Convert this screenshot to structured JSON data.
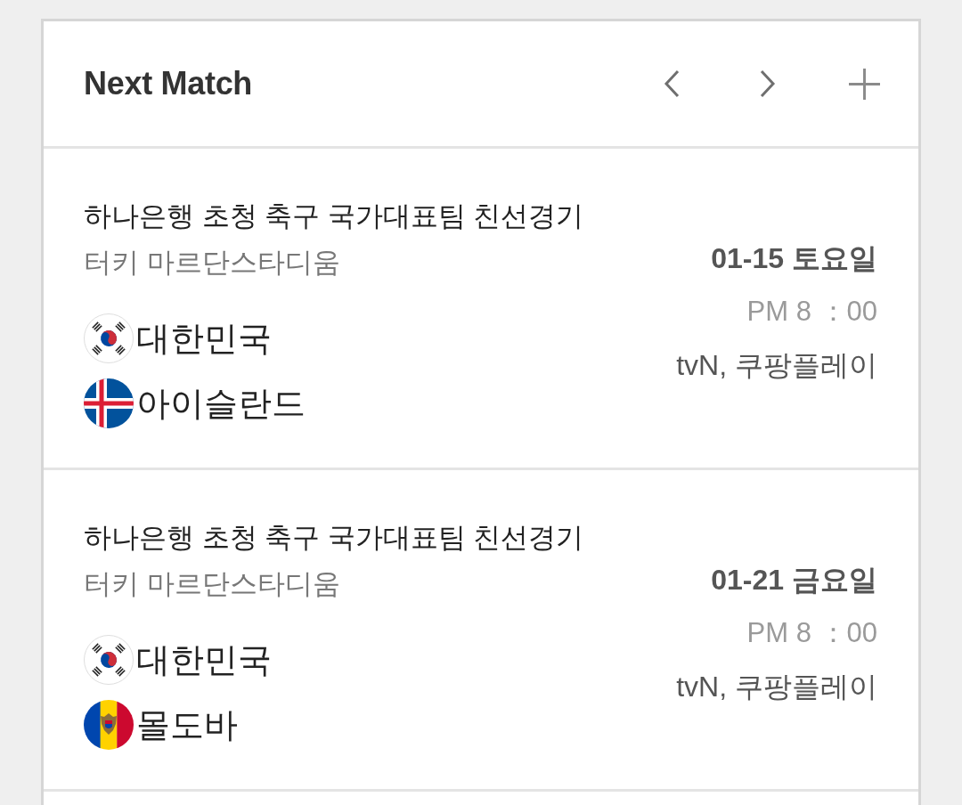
{
  "header": {
    "title": "Next Match"
  },
  "matches": [
    {
      "title": "하나은행 초청 축구 국가대표팀 친선경기",
      "venue": "터키 마르단스타디움",
      "teams": [
        {
          "name": "대한민국",
          "kind": "korea"
        },
        {
          "name": "아이슬란드",
          "kind": "iceland"
        }
      ],
      "date": "01-15 토요일",
      "time": "PM 8 ：00",
      "broadcast": "tvN, 쿠팡플레이"
    },
    {
      "title": "하나은행 초청 축구 국가대표팀 친선경기",
      "venue": "터키 마르단스타디움",
      "teams": [
        {
          "name": "대한민국",
          "kind": "korea"
        },
        {
          "name": "몰도바",
          "kind": "moldova"
        }
      ],
      "date": "01-21 금요일",
      "time": "PM 8 ：00",
      "broadcast": "tvN, 쿠팡플레이"
    }
  ]
}
